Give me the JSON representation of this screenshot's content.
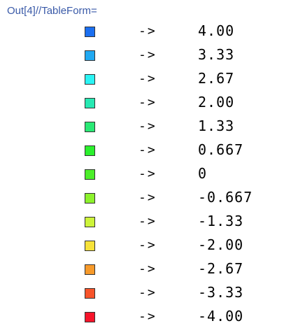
{
  "header": {
    "label": "Out[4]//TableForm="
  },
  "rows": [
    {
      "color": "#1b6ff0",
      "arrow": "->",
      "value": "4.00"
    },
    {
      "color": "#21a9f2",
      "arrow": "->",
      "value": "3.33"
    },
    {
      "color": "#2af4f4",
      "arrow": "->",
      "value": "2.67"
    },
    {
      "color": "#27e9b3",
      "arrow": "->",
      "value": "2.00"
    },
    {
      "color": "#2ae975",
      "arrow": "->",
      "value": "1.33"
    },
    {
      "color": "#2bf02d",
      "arrow": "->",
      "value": "0.667"
    },
    {
      "color": "#4cee2a",
      "arrow": "->",
      "value": "0"
    },
    {
      "color": "#8cf22c",
      "arrow": "->",
      "value": "-0.667"
    },
    {
      "color": "#cdf43a",
      "arrow": "->",
      "value": "-1.33"
    },
    {
      "color": "#f7e23a",
      "arrow": "->",
      "value": "-2.00"
    },
    {
      "color": "#f79a2a",
      "arrow": "->",
      "value": "-2.67"
    },
    {
      "color": "#f7542a",
      "arrow": "->",
      "value": "-3.33"
    },
    {
      "color": "#f7142a",
      "arrow": "->",
      "value": "-4.00"
    }
  ]
}
